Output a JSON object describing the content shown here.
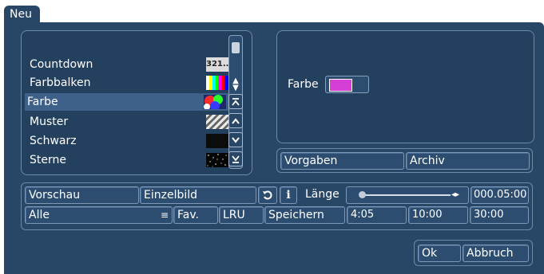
{
  "tab": {
    "label": "Neu"
  },
  "list": {
    "items": [
      {
        "label": "Countdown",
        "thumb_text": "321.."
      },
      {
        "label": "Farbbalken"
      },
      {
        "label": "Farbe"
      },
      {
        "label": "Muster"
      },
      {
        "label": "Schwarz"
      },
      {
        "label": "Sterne"
      }
    ],
    "selected_index": 2
  },
  "properties": {
    "farbe_label": "Farbe",
    "farbe_color": "#d63fd6"
  },
  "preset_buttons": {
    "vorgaben": "Vorgaben",
    "archiv": "Archiv"
  },
  "row1": {
    "vorschau": "Vorschau",
    "einzelbild": "Einzelbild",
    "info": "i",
    "laenge_label": "Länge",
    "duration": "000.05:00"
  },
  "row2": {
    "alle": "Alle",
    "fav": "Fav.",
    "lru": "LRU",
    "speichern": "Speichern",
    "t1": "4:05",
    "t2": "10:00",
    "t3": "30:00"
  },
  "footer": {
    "ok": "Ok",
    "abbruch": "Abbruch"
  },
  "colors": {
    "dialog_bg": "#284766",
    "selection": "#3d6189",
    "button_border": "#7f98b6"
  }
}
